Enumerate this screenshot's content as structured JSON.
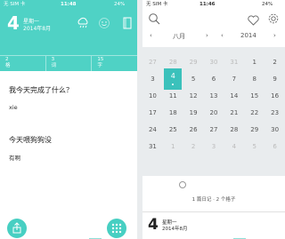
{
  "left": {
    "status": {
      "carrier": "无 SIM 卡",
      "time": "11:48",
      "battery": "24%"
    },
    "header": {
      "day": "4",
      "weekday": "星期一",
      "year_month": "2014年8月",
      "weather_icon": "cloud-rain-icon",
      "face_icon": "smiley-icon",
      "notes_icon": "notebook-icon"
    },
    "stats": [
      {
        "n": "2",
        "unit": "格"
      },
      {
        "n": "3",
        "unit": "词"
      },
      {
        "n": "15",
        "unit": "字"
      }
    ],
    "entries": [
      {
        "question": "我今天完成了什么？",
        "answer": "xie"
      },
      {
        "question": "今天喂狗狗没",
        "answer": "有啊"
      }
    ],
    "footer": {
      "share_icon": "share-icon",
      "grid_icon": "grid-icon"
    }
  },
  "right": {
    "status": {
      "carrier": "无 SIM 卡",
      "time": "11:46",
      "battery": "24%"
    },
    "toolbar": {
      "search_icon": "search-icon",
      "heart_icon": "heart-icon",
      "settings_icon": "gear-icon"
    },
    "nav": {
      "month": "八月",
      "year": "2014",
      "prev": "‹",
      "next": "›"
    },
    "weekdays": [
      "",
      "",
      "",
      "",
      "",
      "",
      ""
    ],
    "weeks": [
      [
        {
          "d": "27",
          "dim": true
        },
        {
          "d": "28",
          "dim": true
        },
        {
          "d": "29",
          "dim": true
        },
        {
          "d": "30",
          "dim": true
        },
        {
          "d": "31",
          "dim": true
        },
        {
          "d": "1"
        },
        {
          "d": "2"
        }
      ],
      [
        {
          "d": "3"
        },
        {
          "d": "4",
          "selected": true
        },
        {
          "d": "5"
        },
        {
          "d": "6"
        },
        {
          "d": "7"
        },
        {
          "d": "8"
        },
        {
          "d": "9"
        }
      ],
      [
        {
          "d": "10"
        },
        {
          "d": "11"
        },
        {
          "d": "12"
        },
        {
          "d": "13"
        },
        {
          "d": "14"
        },
        {
          "d": "15"
        },
        {
          "d": "16"
        }
      ],
      [
        {
          "d": "17"
        },
        {
          "d": "18"
        },
        {
          "d": "19"
        },
        {
          "d": "20"
        },
        {
          "d": "21"
        },
        {
          "d": "22"
        },
        {
          "d": "23"
        }
      ],
      [
        {
          "d": "24"
        },
        {
          "d": "25"
        },
        {
          "d": "26"
        },
        {
          "d": "27"
        },
        {
          "d": "28"
        },
        {
          "d": "29"
        },
        {
          "d": "30"
        }
      ],
      [
        {
          "d": "31"
        },
        {
          "d": "1",
          "dim": true
        },
        {
          "d": "2",
          "dim": true
        },
        {
          "d": "3",
          "dim": true
        },
        {
          "d": "4",
          "dim": true
        },
        {
          "d": "5",
          "dim": true
        },
        {
          "d": "6",
          "dim": true
        }
      ]
    ],
    "summary": {
      "diaries": "1 篇日记",
      "grids": "2 个格子",
      "sep": " · "
    },
    "footer": {
      "day": "4",
      "weekday": "星期一",
      "year_month": "2014年8月"
    }
  },
  "colors": {
    "accent": "#4fd2c5",
    "selected": "#3bc1bb"
  }
}
